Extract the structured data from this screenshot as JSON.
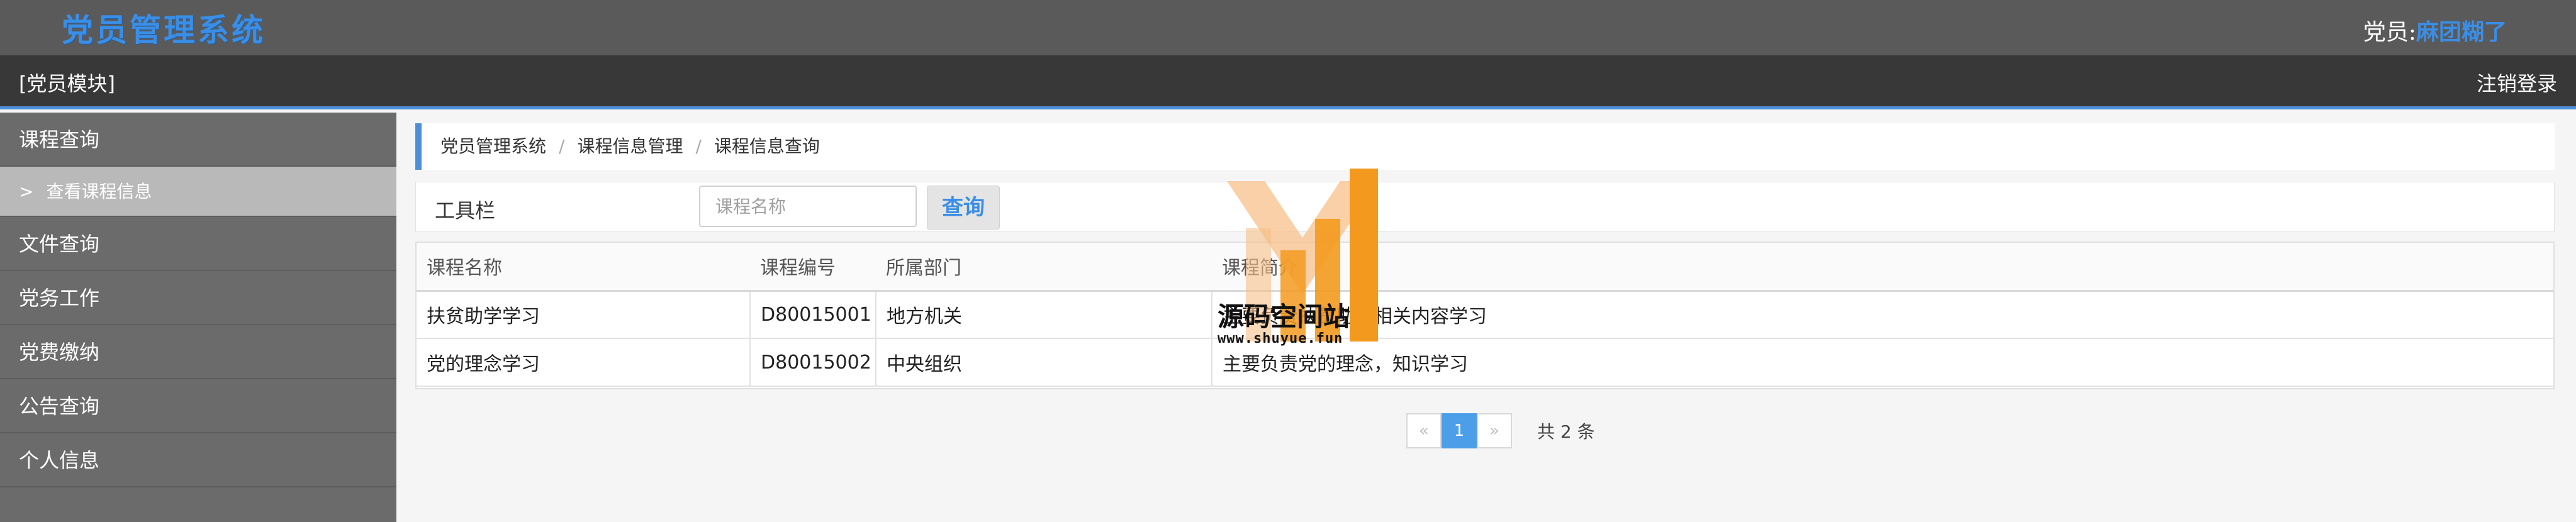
{
  "header": {
    "app_title": "党员管理系统",
    "user_label": "党员:",
    "user_name": "麻团糊了"
  },
  "module_bar": {
    "module_name": "[党员模块]",
    "logout_label": "注销登录"
  },
  "sidebar": {
    "items": [
      {
        "label": "课程查询",
        "children": [
          {
            "arrow": ">",
            "label": "查看课程信息"
          }
        ]
      },
      {
        "label": "文件查询"
      },
      {
        "label": "党务工作"
      },
      {
        "label": "党费缴纳"
      },
      {
        "label": "公告查询"
      },
      {
        "label": "个人信息"
      }
    ]
  },
  "breadcrumb": {
    "items": [
      "党员管理系统",
      "课程信息管理",
      "课程信息查询"
    ],
    "separator": "/"
  },
  "toolbar": {
    "label": "工具栏",
    "search_placeholder": "课程名称",
    "search_value": "",
    "search_button": "查询"
  },
  "table": {
    "columns": [
      "课程名称",
      "课程编号",
      "所属部门",
      "课程简介"
    ],
    "rows": [
      [
        "扶贫助学学习",
        "D80015001",
        "地方机关",
        "主要负责扶贫助学相关内容学习"
      ],
      [
        "党的理念学习",
        "D80015002",
        "中央组织",
        "主要负责党的理念，知识学习"
      ]
    ]
  },
  "pagination": {
    "prev": "«",
    "current": "1",
    "next": "»",
    "total": "共 2 条"
  },
  "watermark": {
    "brand": "源码空间站",
    "url": "www.shuyue.fun",
    "colors": {
      "primary": "#f39a1e",
      "light": "#f7c089"
    }
  },
  "colors": {
    "accent": "#3a8ee6",
    "header_bg": "#5a5a5a",
    "module_bar_bg": "#383838",
    "sidebar_bg": "#6b6b6b",
    "sidebar_active_bg": "#b9b9b9",
    "page_active": "#4d9ee8"
  }
}
